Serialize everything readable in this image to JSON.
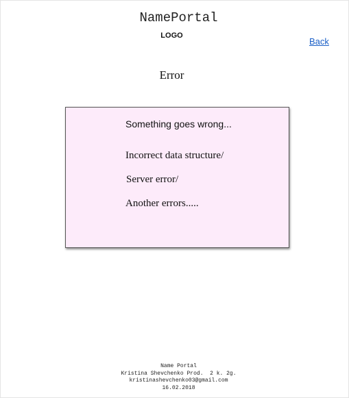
{
  "header": {
    "brand": "NamePortal",
    "logo_text": "LOGO",
    "back_label": "Back"
  },
  "main": {
    "heading": "Error",
    "error_box": {
      "summary": "Something goes wrong...",
      "errors": [
        "Incorrect data structure/",
        "Server error/",
        "Another errors....."
      ]
    }
  },
  "footer": {
    "lines": [
      "Name Portal",
      "Kristina Shevchenko Prod.  2 k. 2g.",
      "kristinashevchenko03@gmail.com",
      "16.02.2018"
    ]
  },
  "colors": {
    "error_box_background": "#fdebfa",
    "link": "#1a5fc7"
  }
}
